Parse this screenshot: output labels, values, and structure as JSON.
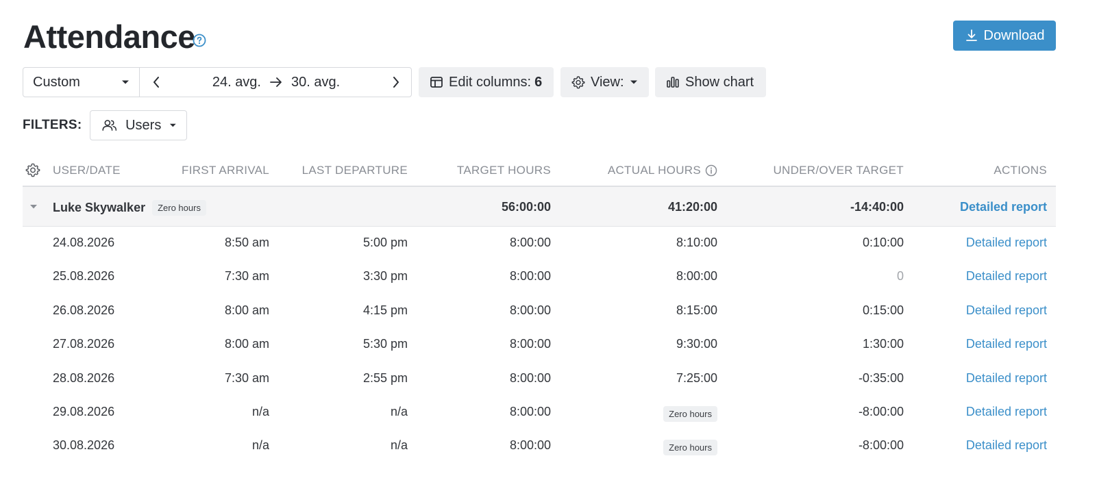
{
  "page": {
    "title": "Attendance",
    "download_label": "Download"
  },
  "toolbar": {
    "period_value": "Custom",
    "range_start": "24. avg.",
    "range_end": "30. avg.",
    "edit_columns_label": "Edit columns:",
    "edit_columns_count": "6",
    "view_label": "View:",
    "show_chart_label": "Show chart"
  },
  "filters": {
    "label": "FILTERS:",
    "users_label": "Users"
  },
  "table": {
    "headers": [
      "USER/DATE",
      "FIRST ARRIVAL",
      "LAST DEPARTURE",
      "TARGET HOURS",
      "ACTUAL HOURS",
      "UNDER/OVER TARGET",
      "ACTIONS"
    ],
    "group": {
      "name": "Luke Skywalker",
      "badge": "Zero hours",
      "target": "56:00:00",
      "actual": "41:20:00",
      "diff": "-14:40:00",
      "action": "Detailed report"
    },
    "rows": [
      {
        "date": "24.08.2026",
        "arrival": "8:50 am",
        "departure": "5:00 pm",
        "target": "8:00:00",
        "actual": "8:10:00",
        "diff": "0:10:00",
        "action": "Detailed report"
      },
      {
        "date": "25.08.2026",
        "arrival": "7:30 am",
        "departure": "3:30 pm",
        "target": "8:00:00",
        "actual": "8:00:00",
        "diff": "0",
        "action": "Detailed report"
      },
      {
        "date": "26.08.2026",
        "arrival": "8:00 am",
        "departure": "4:15 pm",
        "target": "8:00:00",
        "actual": "8:15:00",
        "diff": "0:15:00",
        "action": "Detailed report"
      },
      {
        "date": "27.08.2026",
        "arrival": "8:00 am",
        "departure": "5:30 pm",
        "target": "8:00:00",
        "actual": "9:30:00",
        "diff": "1:30:00",
        "action": "Detailed report"
      },
      {
        "date": "28.08.2026",
        "arrival": "7:30 am",
        "departure": "2:55 pm",
        "target": "8:00:00",
        "actual": "7:25:00",
        "diff": "-0:35:00",
        "action": "Detailed report"
      },
      {
        "date": "29.08.2026",
        "arrival": "n/a",
        "departure": "n/a",
        "target": "8:00:00",
        "actual": "Zero hours",
        "diff": "-8:00:00",
        "action": "Detailed report"
      },
      {
        "date": "30.08.2026",
        "arrival": "n/a",
        "departure": "n/a",
        "target": "8:00:00",
        "actual": "Zero hours",
        "diff": "-8:00:00",
        "action": "Detailed report"
      }
    ]
  },
  "colors": {
    "accent": "#3b8fc9",
    "text": "#2a2d33",
    "header_text": "#8a8e95",
    "group_bg": "#f5f5f6"
  },
  "icons": [
    "help-icon",
    "download-icon",
    "caret-down-icon",
    "chevron-left-icon",
    "arrow-right-icon",
    "chevron-right-icon",
    "columns-icon",
    "gear-icon",
    "bar-chart-icon",
    "users-icon",
    "info-icon",
    "expand-caret-icon"
  ]
}
